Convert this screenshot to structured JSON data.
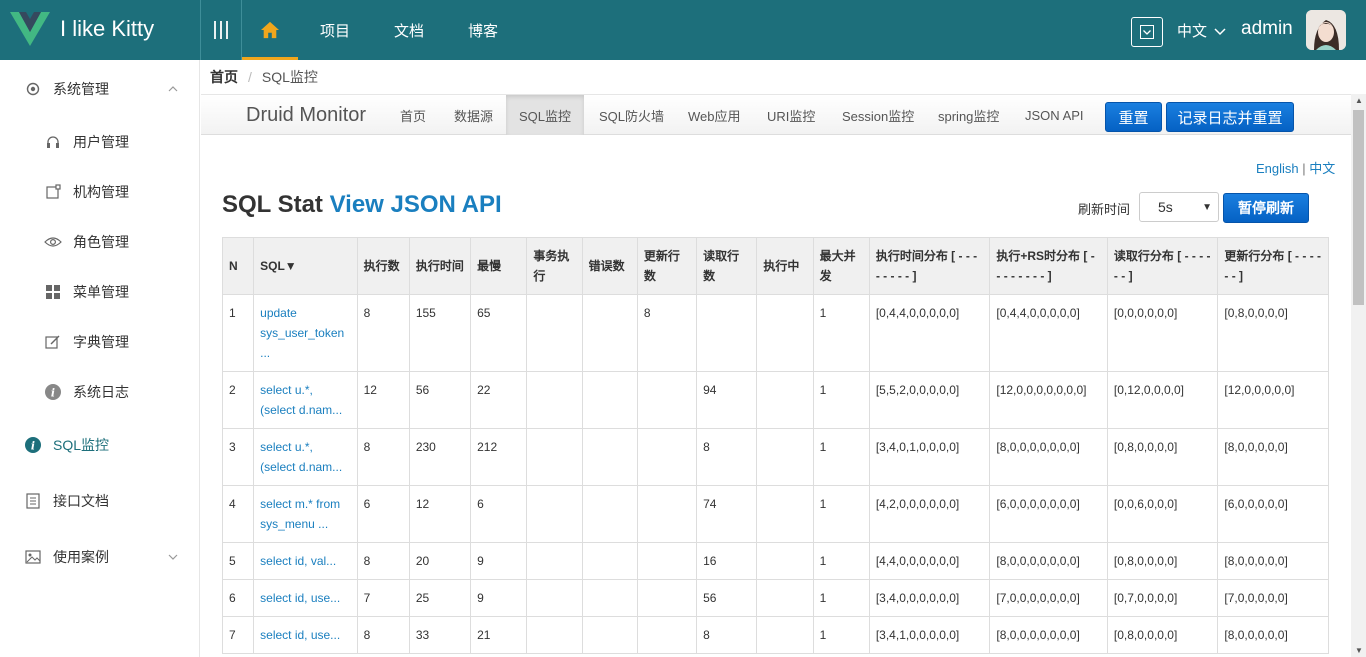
{
  "header": {
    "brand": "I like Kitty",
    "nav": [
      "项目",
      "文档",
      "博客"
    ],
    "lang": "中文",
    "user": "admin"
  },
  "sidebar": {
    "items": [
      {
        "label": "系统管理",
        "icon": "gear-icon",
        "level": 1,
        "expandable": true,
        "expanded": true
      },
      {
        "label": "用户管理",
        "icon": "headset-icon",
        "level": 2
      },
      {
        "label": "机构管理",
        "icon": "org-icon",
        "level": 2
      },
      {
        "label": "角色管理",
        "icon": "eye-icon",
        "level": 2
      },
      {
        "label": "菜单管理",
        "icon": "grid-icon",
        "level": 2
      },
      {
        "label": "字典管理",
        "icon": "edit-icon",
        "level": 2
      },
      {
        "label": "系统日志",
        "icon": "info-icon",
        "level": 2
      },
      {
        "label": "SQL监控",
        "icon": "info-icon",
        "level": 1,
        "active": true
      },
      {
        "label": "接口文档",
        "icon": "document-icon",
        "level": 1
      },
      {
        "label": "使用案例",
        "icon": "image-icon",
        "level": 1,
        "expandable": true,
        "expanded": false
      }
    ]
  },
  "breadcrumb": {
    "home": "首页",
    "separator": "/",
    "current": "SQL监控"
  },
  "druid": {
    "title": "Druid Monitor",
    "nav": [
      "首页",
      "数据源",
      "SQL监控",
      "SQL防火墙",
      "Web应用",
      "URI监控",
      "Session监控",
      "spring监控",
      "JSON API"
    ],
    "active_nav": "SQL监控",
    "reset_button": "重置",
    "log_reset_button": "记录日志并重置",
    "lang_en": "English",
    "lang_sep": "|",
    "lang_zh": "中文",
    "stat_title": "SQL Stat",
    "stat_link": "View JSON API",
    "refresh_label": "刷新时间",
    "refresh_value": "5s",
    "pause_button": "暂停刷新"
  },
  "table": {
    "headers": [
      "N",
      "SQL▼",
      "执行数",
      "执行时间",
      "最慢",
      "事务执行",
      "错误数",
      "更新行数",
      "读取行数",
      "执行中",
      "最大并发",
      "执行时间分布 [ - - - - - - - - ]",
      "执行+RS时分布 [ - - - - - - - - ]",
      "读取行分布 [ - - - - - - ]",
      "更新行分布 [ - - - - - - ]"
    ],
    "rows": [
      [
        "1",
        "update sys_user_token ...",
        "8",
        "155",
        "65",
        "",
        "",
        "8",
        "",
        "",
        "1",
        "[0,4,4,0,0,0,0,0]",
        "[0,4,4,0,0,0,0,0]",
        "[0,0,0,0,0,0]",
        "[0,8,0,0,0,0]"
      ],
      [
        "2",
        "select u.*, (select d.nam...",
        "12",
        "56",
        "22",
        "",
        "",
        "",
        "94",
        "",
        "1",
        "[5,5,2,0,0,0,0,0]",
        "[12,0,0,0,0,0,0,0]",
        "[0,12,0,0,0,0]",
        "[12,0,0,0,0,0]"
      ],
      [
        "3",
        "select u.*, (select d.nam...",
        "8",
        "230",
        "212",
        "",
        "",
        "",
        "8",
        "",
        "1",
        "[3,4,0,1,0,0,0,0]",
        "[8,0,0,0,0,0,0,0]",
        "[0,8,0,0,0,0]",
        "[8,0,0,0,0,0]"
      ],
      [
        "4",
        "select m.* from sys_menu ...",
        "6",
        "12",
        "6",
        "",
        "",
        "",
        "74",
        "",
        "1",
        "[4,2,0,0,0,0,0,0]",
        "[6,0,0,0,0,0,0,0]",
        "[0,0,6,0,0,0]",
        "[6,0,0,0,0,0]"
      ],
      [
        "5",
        "select id, val...",
        "8",
        "20",
        "9",
        "",
        "",
        "",
        "16",
        "",
        "1",
        "[4,4,0,0,0,0,0,0]",
        "[8,0,0,0,0,0,0,0]",
        "[0,8,0,0,0,0]",
        "[8,0,0,0,0,0]"
      ],
      [
        "6",
        "select id, use...",
        "7",
        "25",
        "9",
        "",
        "",
        "",
        "56",
        "",
        "1",
        "[3,4,0,0,0,0,0,0]",
        "[7,0,0,0,0,0,0,0]",
        "[0,7,0,0,0,0]",
        "[7,0,0,0,0,0]"
      ],
      [
        "7",
        "select id, use...",
        "8",
        "33",
        "21",
        "",
        "",
        "",
        "8",
        "",
        "1",
        "[3,4,1,0,0,0,0,0]",
        "[8,0,0,0,0,0,0,0]",
        "[0,8,0,0,0,0]",
        "[8,0,0,0,0,0]"
      ]
    ]
  }
}
